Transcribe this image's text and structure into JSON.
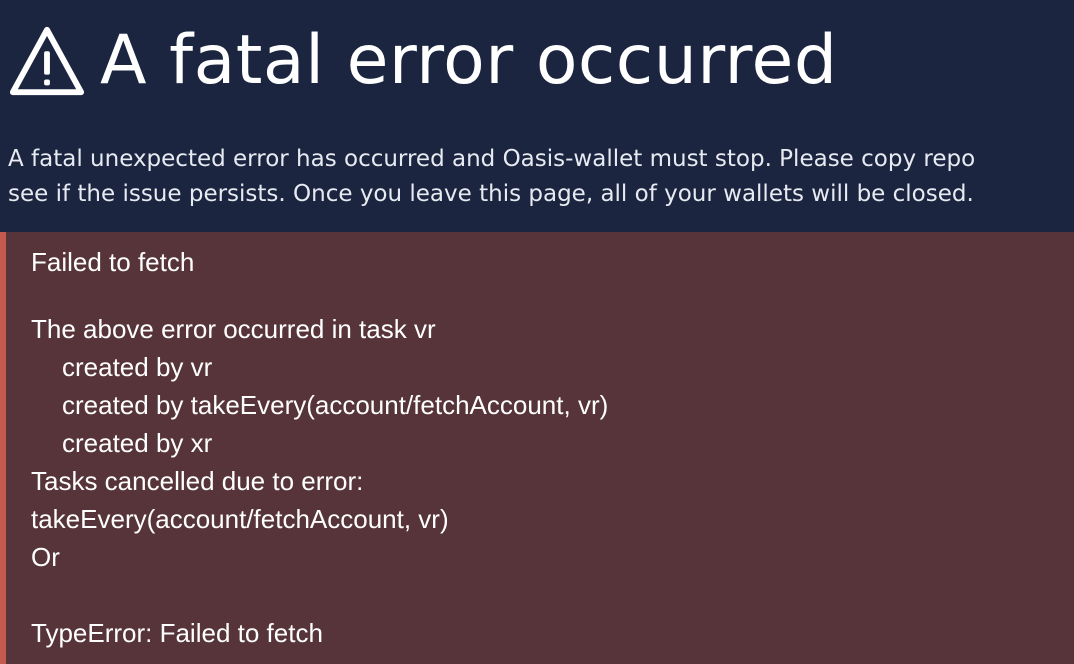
{
  "header": {
    "icon": "warning-triangle-icon",
    "title": "A fatal error occurred"
  },
  "description": {
    "line1": "A fatal unexpected error has occurred and Oasis-wallet must stop. Please copy repo",
    "line2": "see if the issue persists. Once you leave this page, all of your wallets will be closed."
  },
  "error": {
    "summary": "Failed to fetch",
    "stack": [
      {
        "text": "The above error occurred in task vr",
        "indent": false
      },
      {
        "text": "created by vr",
        "indent": true
      },
      {
        "text": "created by takeEvery(account/fetchAccount, vr)",
        "indent": true
      },
      {
        "text": "created by xr",
        "indent": true
      },
      {
        "text": "Tasks cancelled due to error:",
        "indent": false
      },
      {
        "text": "takeEvery(account/fetchAccount, vr)",
        "indent": false
      },
      {
        "text": "Or",
        "indent": false
      },
      {
        "text": "",
        "indent": false
      },
      {
        "text": "TypeError: Failed to fetch",
        "indent": false
      }
    ]
  },
  "colors": {
    "background": "#1b2540",
    "error_panel": "#563439",
    "error_border": "#c45a4f",
    "text": "#ffffff"
  }
}
